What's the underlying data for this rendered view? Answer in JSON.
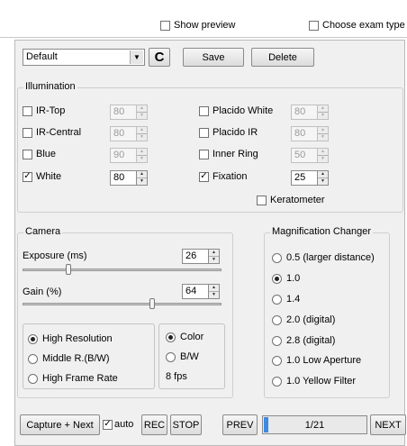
{
  "top": {
    "show_preview": "Show preview",
    "choose_exam_type": "Choose exam type"
  },
  "preset": {
    "selected": "Default",
    "save": "Save",
    "delete": "Delete",
    "refresh_icon": "C"
  },
  "illumination": {
    "title": "Illumination",
    "items": [
      {
        "label": "IR-Top",
        "checked": false,
        "value": "80",
        "enabled": false
      },
      {
        "label": "IR-Central",
        "checked": false,
        "value": "80",
        "enabled": false
      },
      {
        "label": "Blue",
        "checked": false,
        "value": "90",
        "enabled": false
      },
      {
        "label": "White",
        "checked": true,
        "value": "80",
        "enabled": true
      },
      {
        "label": "Placido White",
        "checked": false,
        "value": "80",
        "enabled": false
      },
      {
        "label": "Placido IR",
        "checked": false,
        "value": "80",
        "enabled": false
      },
      {
        "label": "Inner Ring",
        "checked": false,
        "value": "50",
        "enabled": false
      },
      {
        "label": "Fixation",
        "checked": true,
        "value": "25",
        "enabled": true
      }
    ],
    "keratometer": "Keratometer"
  },
  "camera": {
    "title": "Camera",
    "exposure_label": "Exposure (ms)",
    "exposure_value": "26",
    "gain_label": "Gain (%)",
    "gain_value": "64",
    "resolution": [
      "High Resolution",
      "Middle R.(B/W)",
      "High Frame Rate"
    ],
    "color_options": [
      "Color",
      "B/W"
    ],
    "fps": "8 fps"
  },
  "magnification": {
    "title": "Magnification Changer",
    "options": [
      "0.5 (larger distance)",
      "1.0",
      "1.4",
      "2.0 (digital)",
      "2.8 (digital)",
      "1.0 Low Aperture",
      "1.0 Yellow Filter"
    ]
  },
  "bottom": {
    "capture_next": "Capture + Next",
    "auto": "auto",
    "rec": "REC",
    "stop": "STOP",
    "prev": "PREV",
    "page": "1/21",
    "next": "NEXT"
  }
}
